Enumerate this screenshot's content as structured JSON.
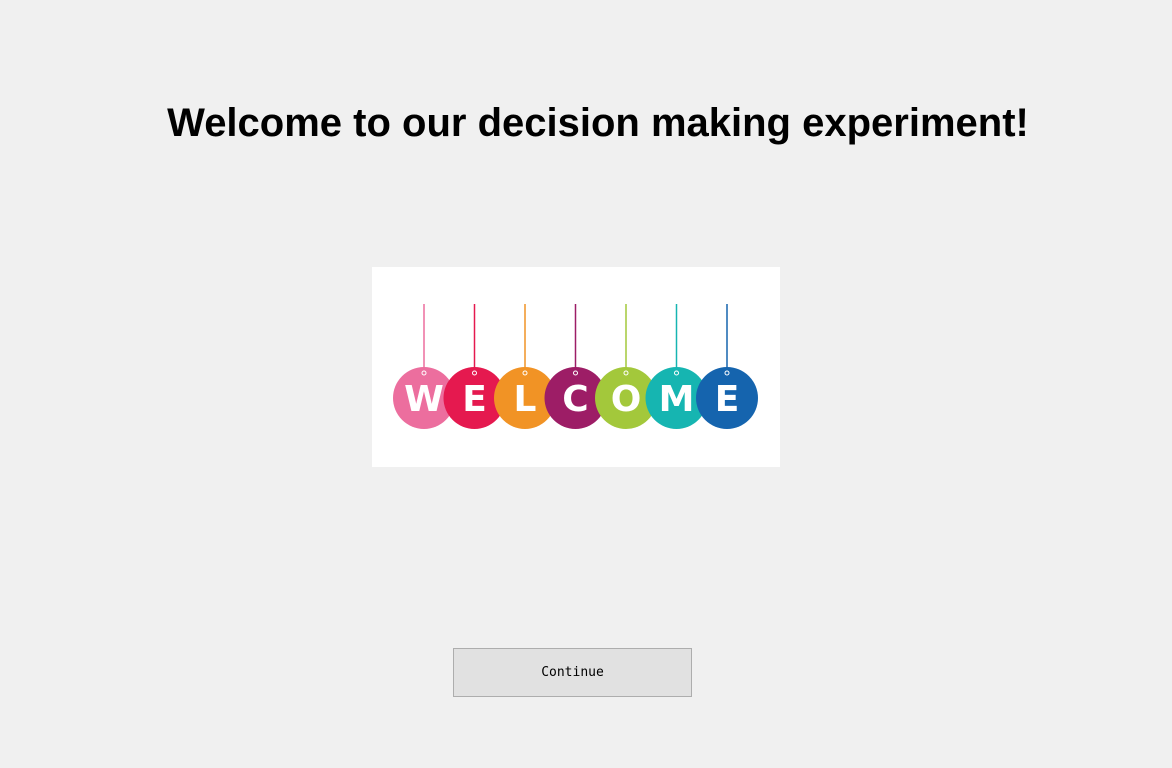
{
  "page": {
    "title": "Welcome to our decision making experiment!"
  },
  "banner": {
    "letters": [
      "W",
      "E",
      "L",
      "C",
      "O",
      "M",
      "E"
    ],
    "colors": [
      "#ec6e9e",
      "#e5194f",
      "#f19325",
      "#9d1d66",
      "#a3c83b",
      "#16b5b1",
      "#1564ae"
    ]
  },
  "buttons": {
    "continue_label": "Continue"
  }
}
